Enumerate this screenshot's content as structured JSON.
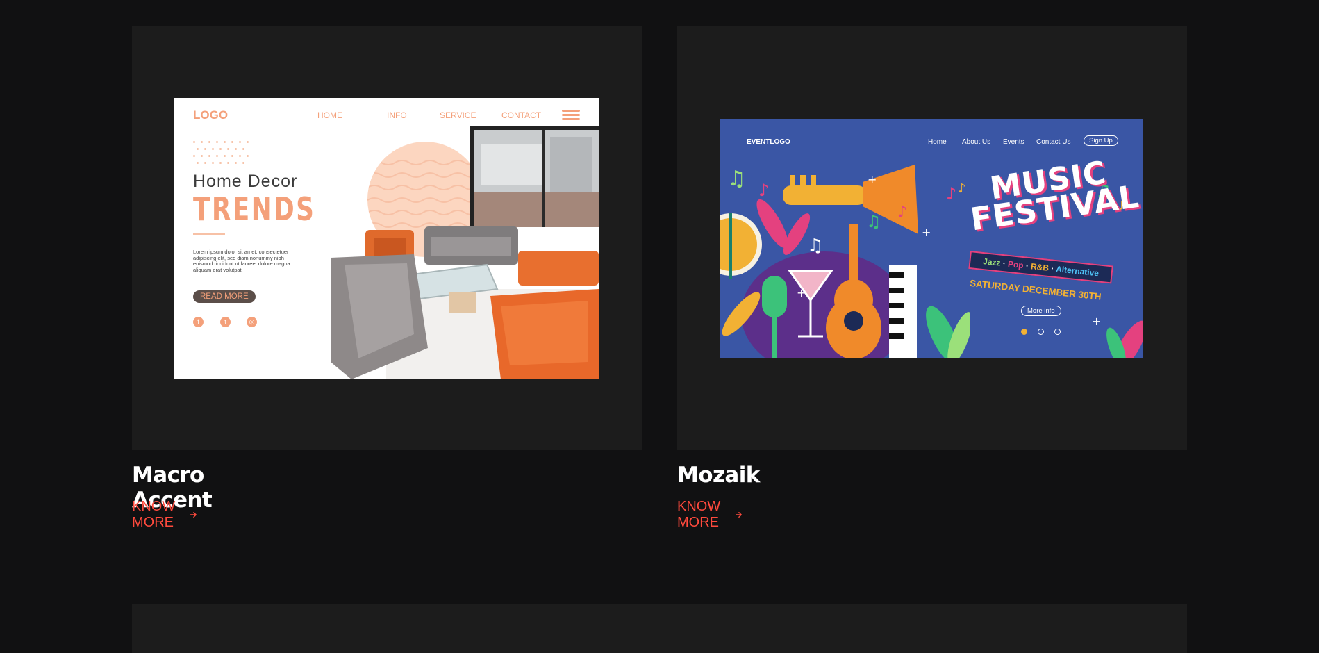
{
  "cards": [
    {
      "title": "Macro Accent",
      "link_label": "KNOW MORE",
      "preview": {
        "logo": "LOGO",
        "nav": [
          "HOME",
          "INFO",
          "SERVICE",
          "CONTACT"
        ],
        "heading_line1": "Home  Decor",
        "heading_line2": "TRENDS",
        "body": "Lorem ipsum dolor sit amet, consectetuer adipiscing elit, sed diam nonummy nibh euismod tincidunt ut laoreet dolore magna aliquam erat volutpat.",
        "button": "READ MORE"
      }
    },
    {
      "title": "Mozaik",
      "link_label": "KNOW MORE",
      "preview": {
        "logo": "EVENTLOGO",
        "nav": [
          "Home",
          "About Us",
          "Events",
          "Contact Us"
        ],
        "signup": "Sign Up",
        "title_line1": "MUSIC",
        "title_line2": "FESTIVAL",
        "genres": [
          "Jazz",
          "Pop",
          "R&B",
          "Alternative"
        ],
        "date": "SATURDAY DECEMBER 30TH",
        "button": "More info"
      }
    }
  ],
  "colors": {
    "page_bg": "#111112",
    "card_bg": "#1c1c1c",
    "accent": "#ff4a3d",
    "title": "#ffffff"
  },
  "icons": [
    "arrow-right-icon",
    "facebook-icon",
    "twitter-icon",
    "instagram-icon",
    "hamburger-menu-icon"
  ]
}
